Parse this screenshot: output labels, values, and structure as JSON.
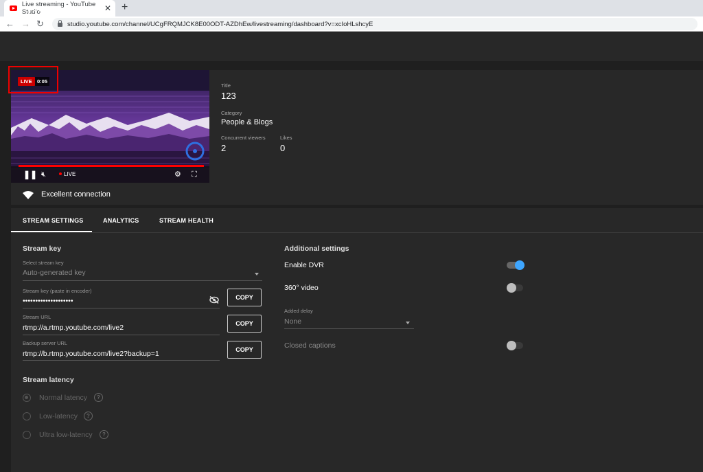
{
  "browser": {
    "tab_title": "Live streaming - YouTube Studio",
    "tab_close": "✕",
    "new_tab": "+",
    "url": "studio.youtube.com/channel/UCgFRQMJCK8E00ODT-AZDhEw/livestreaming/dashboard?v=xcIoHLshcyE"
  },
  "header": {
    "back": "←",
    "title": "123"
  },
  "player": {
    "live_badge": "LIVE",
    "elapsed": "0:05",
    "live_indicator": "LIVE"
  },
  "stream_info": {
    "title_label": "Title",
    "title_value": "123",
    "category_label": "Category",
    "category_value": "People & Blogs",
    "viewers_label": "Concurrent viewers",
    "viewers_value": "2",
    "likes_label": "Likes",
    "likes_value": "0"
  },
  "connection": {
    "status": "Excellent connection"
  },
  "tabs": [
    {
      "label": "STREAM SETTINGS",
      "active": true
    },
    {
      "label": "ANALYTICS",
      "active": false
    },
    {
      "label": "STREAM HEALTH",
      "active": false
    }
  ],
  "stream_key": {
    "section_title": "Stream key",
    "select_label": "Select stream key",
    "select_value": "Auto-generated key",
    "key_label": "Stream key (paste in encoder)",
    "key_value": "••••••••••••••••••••",
    "url_label": "Stream URL",
    "url_value": "rtmp://a.rtmp.youtube.com/live2",
    "backup_label": "Backup server URL",
    "backup_value": "rtmp://b.rtmp.youtube.com/live2?backup=1",
    "copy_label": "COPY"
  },
  "latency": {
    "section_title": "Stream latency",
    "options": [
      {
        "label": "Normal latency",
        "checked": true
      },
      {
        "label": "Low-latency",
        "checked": false
      },
      {
        "label": "Ultra low-latency",
        "checked": false
      }
    ],
    "help": "?"
  },
  "additional": {
    "section_title": "Additional settings",
    "dvr_label": "Enable DVR",
    "dvr_on": true,
    "video360_label": "360° video",
    "video360_on": false,
    "delay_label": "Added delay",
    "delay_value": "None",
    "captions_label": "Closed captions",
    "captions_on": false
  },
  "colors": {
    "accent": "#3ea6ff",
    "live_red": "#cc0000",
    "background": "#1f1f1f",
    "panel": "#282828"
  }
}
